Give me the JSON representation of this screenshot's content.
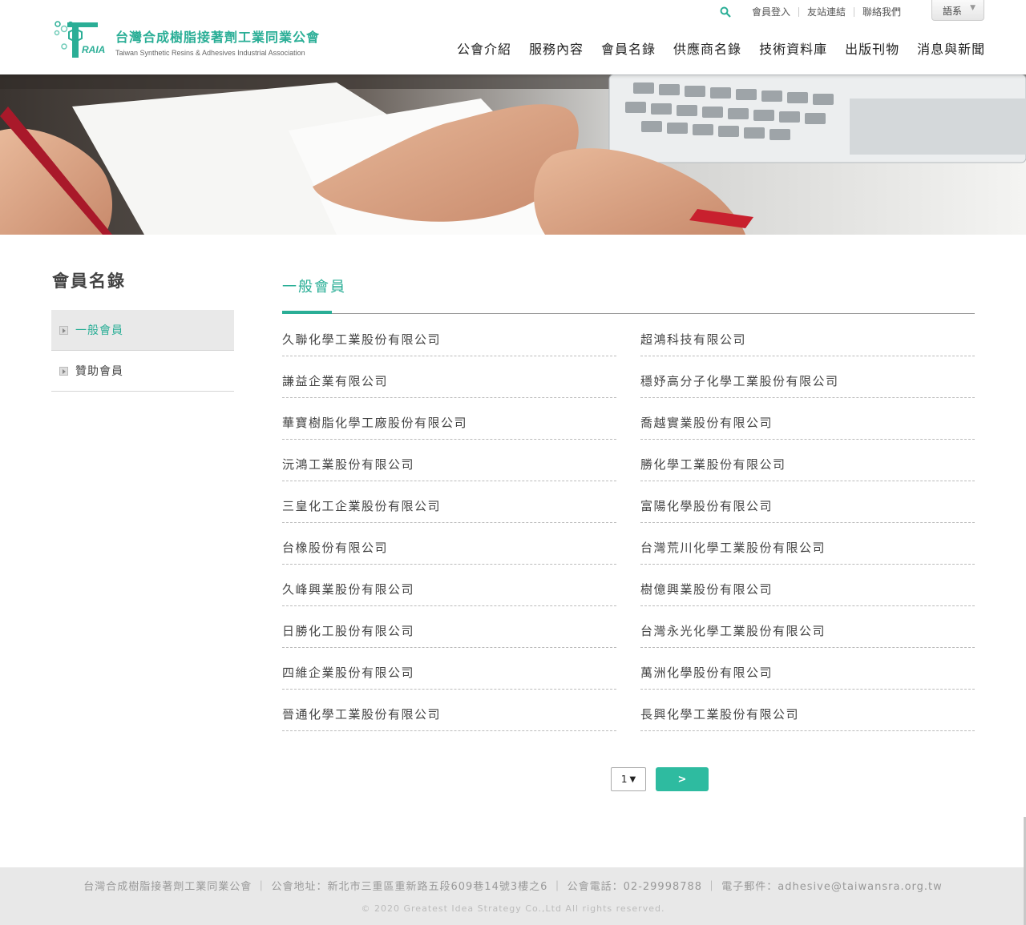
{
  "header": {
    "logo": {
      "title": "台灣合成樹脂接著劑工業同業公會",
      "subtitle": "Taiwan Synthetic Resins & Adhesives Industrial Association",
      "mark_text": "RAIA"
    },
    "util_links": [
      "會員登入",
      "友站連結",
      "聯絡我們"
    ],
    "language_label": "語系",
    "nav": [
      "公會介紹",
      "服務內容",
      "會員名錄",
      "供應商名錄",
      "技術資料庫",
      "出版刊物",
      "消息與新聞"
    ]
  },
  "sidebar": {
    "title": "會員名錄",
    "items": [
      {
        "label": "一般會員",
        "active": true
      },
      {
        "label": "贊助會員",
        "active": false
      }
    ]
  },
  "main": {
    "title": "一般會員",
    "members": [
      "久聯化學工業股份有限公司",
      "超鴻科技有限公司",
      "謙益企業有限公司",
      "穩妤高分子化學工業股份有限公司",
      "華寶樹脂化學工廠股份有限公司",
      "喬越實業股份有限公司",
      "沅鴻工業股份有限公司",
      "勝化學工業股份有限公司",
      "三皇化工企業股份有限公司",
      "富陽化學股份有限公司",
      "台橡股份有限公司",
      "台灣荒川化學工業股份有限公司",
      "久峰興業股份有限公司",
      "樹億興業股份有限公司",
      "日勝化工股份有限公司",
      "台灣永光化學工業股份有限公司",
      "四維企業股份有限公司",
      "萬洲化學股份有限公司",
      "晉通化學工業股份有限公司",
      "長興化學工業股份有限公司"
    ]
  },
  "pager": {
    "page": "1",
    "next_label": ">"
  },
  "footer": {
    "info": "台灣合成樹脂接著劑工業同業公會 ｜ 公會地址：新北市三重區重新路五段609巷14號3樓之6 ｜ 公會電話：02-29998788 ｜ 電子郵件：adhesive@taiwansra.org.tw",
    "copyright": "© 2020 Greatest Idea Strategy Co.,Ltd All rights reserved."
  },
  "colors": {
    "accent": "#2aae96",
    "button": "#2ebba0",
    "footer_bg": "#e8e8e8"
  },
  "icons": [
    "search-icon",
    "chevron-down-icon",
    "box-arrow-icon"
  ]
}
